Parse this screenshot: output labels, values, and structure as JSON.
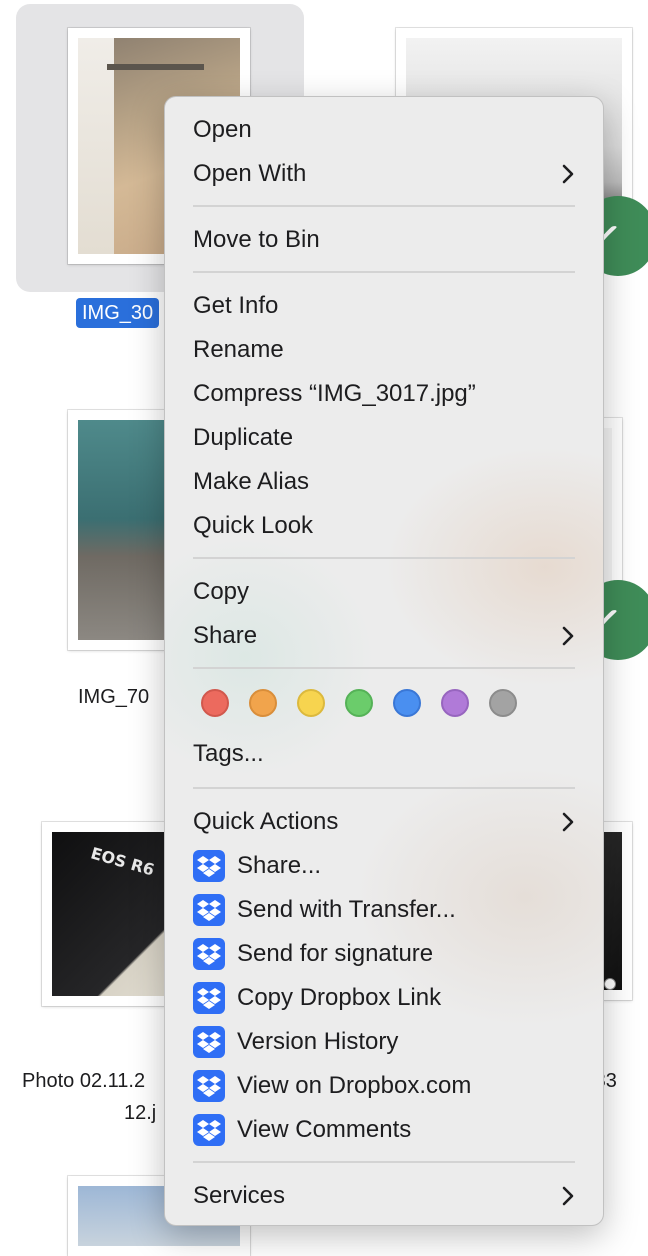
{
  "finder": {
    "files": [
      {
        "label": "IMG_30"
      },
      {
        "label": "IMG_70"
      },
      {
        "label": "Photo 02.11.2"
      },
      {
        "label": "12.j"
      },
      {
        "label": "9 33"
      }
    ]
  },
  "menu": {
    "open": "Open",
    "open_with": "Open With",
    "move_to_bin": "Move to Bin",
    "get_info": "Get Info",
    "rename": "Rename",
    "compress": "Compress “IMG_3017.jpg”",
    "duplicate": "Duplicate",
    "make_alias": "Make Alias",
    "quick_look": "Quick Look",
    "copy": "Copy",
    "share": "Share",
    "tags": "Tags...",
    "quick_actions": "Quick Actions",
    "dropbox_actions": [
      "Share...",
      "Send with Transfer...",
      "Send for signature",
      "Copy Dropbox Link",
      "Version History",
      "View on Dropbox.com",
      "View Comments"
    ],
    "services": "Services"
  },
  "tag_colors": [
    {
      "name": "red",
      "fill": "#ec6a5e",
      "stroke": "#d1584d"
    },
    {
      "name": "orange",
      "fill": "#f1a44c",
      "stroke": "#d98e3a"
    },
    {
      "name": "yellow",
      "fill": "#f7d44f",
      "stroke": "#dcb93d"
    },
    {
      "name": "green",
      "fill": "#6bcc6b",
      "stroke": "#55b257"
    },
    {
      "name": "blue",
      "fill": "#4a8ff0",
      "stroke": "#3a77d6"
    },
    {
      "name": "purple",
      "fill": "#b07ad8",
      "stroke": "#9765bf"
    },
    {
      "name": "gray",
      "fill": "#a3a3a3",
      "stroke": "#8c8c8c"
    }
  ],
  "colors": {
    "selection": "#2a6fdb",
    "dropbox": "#2f6ef5",
    "badge": "#3f8c58"
  }
}
